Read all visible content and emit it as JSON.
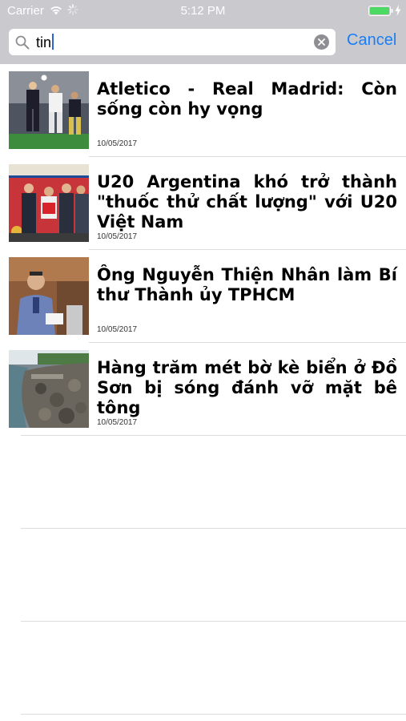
{
  "status_bar": {
    "carrier": "Carrier",
    "time": "5:12 PM",
    "battery_level": 1.0,
    "battery_color": "#4cd964"
  },
  "search": {
    "query": "tin",
    "cancel_label": "Cancel"
  },
  "colors": {
    "accent": "#1a7ef7",
    "search_bar_bg": "#c9c9ce"
  },
  "results": [
    {
      "title": "Atletico - Real Madrid: Còn sống còn hy vọng",
      "date": "10/05/2017"
    },
    {
      "title": "U20 Argentina khó trở thành \"thuốc thử chất lượng\" với U20 Việt Nam",
      "date": "10/05/2017"
    },
    {
      "title": "Ông Nguyễn Thiện Nhân làm Bí thư Thành ủy TPHCM",
      "date": "10/05/2017"
    },
    {
      "title": "Hàng trăm mét bờ kè biển ở Đồ Sơn bị sóng đánh vỡ mặt bê tông",
      "date": "10/05/2017"
    }
  ]
}
